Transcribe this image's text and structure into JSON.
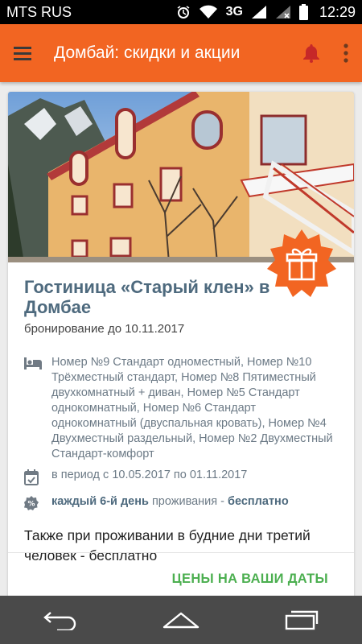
{
  "status_bar": {
    "carrier": "MTS RUS",
    "network": "3G",
    "time": "12:29"
  },
  "app_bar": {
    "title": "Домбай: скидки и акции"
  },
  "offer": {
    "title": "Гостиница «Старый клен» в Домбае",
    "booking": "бронирование до 10.11.2017",
    "rooms": "Номер №9 Стандарт одноместный, Номер №10 Трёхместный стандарт, Номер №8 Пятиместный двухкомнатный + диван, Номер №5 Стандарт однокомнатный, Номер №6 Стандарт однокомнатный (двуспальная кровать), Номер №4 Двухместный раздельный, Номер №2 Двухместный Стандарт-комфорт",
    "period": "в период с 10.05.2017 по 01.11.2017",
    "discount_bold1": "каждый 6-й день",
    "discount_mid": " проживания - ",
    "discount_bold2": "бесплатно",
    "extra": "Также при проживании в будние дни третий человек - бесплатно",
    "cta": "ЦЕНЫ НА ВАШИ ДАТЫ"
  },
  "colors": {
    "accent": "#f26522",
    "title": "#4e6a7e",
    "cta": "#4caf50"
  },
  "icons": {
    "menu": "hamburger-icon",
    "bell": "bell-icon",
    "more": "more-vert-icon",
    "gift": "gift-icon",
    "bed": "bed-icon",
    "calendar": "calendar-check-icon",
    "percent": "percent-badge-icon"
  }
}
